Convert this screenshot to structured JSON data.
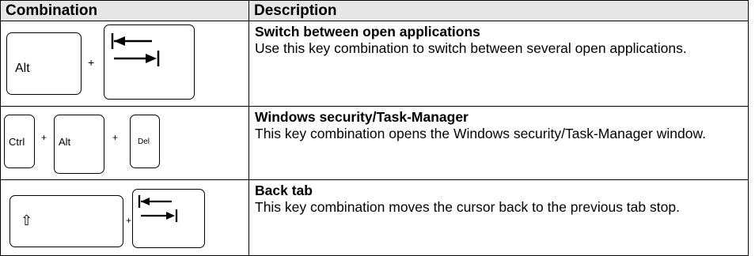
{
  "headers": {
    "combination": "Combination",
    "description": "Description"
  },
  "rows": [
    {
      "keys": {
        "k1": "Alt",
        "plus1": "+",
        "k2_icon": "tab-arrows-icon"
      },
      "title": "Switch between open applications",
      "text": "Use this key combination to switch between several open applications."
    },
    {
      "keys": {
        "k1": "Ctrl",
        "plus1": "+",
        "k2": "Alt",
        "plus2": "+",
        "k3": "Del"
      },
      "title": "Windows security/Task-Manager",
      "text": "This key combination opens the Windows security/Task-Manager window."
    },
    {
      "keys": {
        "k1": "⇧",
        "plus1": "+",
        "k2_icon": "tab-arrows-icon"
      },
      "title": "Back tab",
      "text": "This key combination moves the cursor back to the previous tab stop."
    }
  ]
}
